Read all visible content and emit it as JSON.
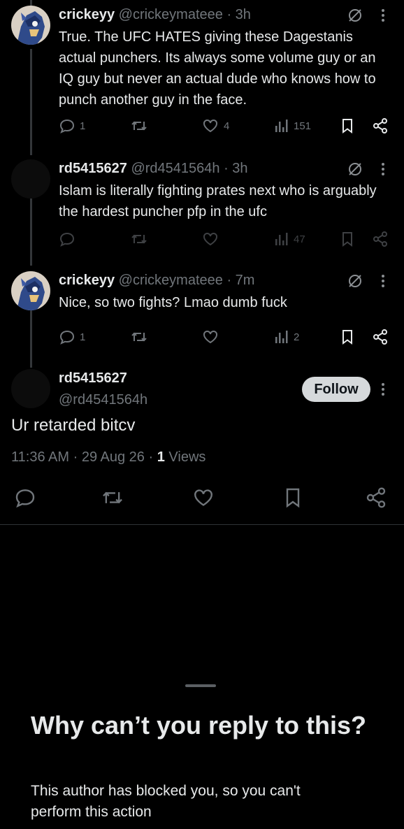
{
  "replies": [
    {
      "name": "crickeyy",
      "handle": "@crickeymateee",
      "time": "· 3h",
      "text": "True. The UFC HATES giving these Dagestanis actual punchers. Its always some volume guy or an IQ guy but never an actual dude who knows how to punch another guy in the face.",
      "replies": "1",
      "retweets": "",
      "likes": "4",
      "views": "151"
    },
    {
      "name": "rd5415627",
      "handle": "@rd4541564h",
      "time": "· 3h",
      "text": "Islam is literally fighting prates next who is arguably the hardest puncher pfp in the ufc",
      "replies": "",
      "retweets": "",
      "likes": "",
      "views": "47"
    },
    {
      "name": "crickeyy",
      "handle": "@crickeymateee",
      "time": "· 7m",
      "text": "Nice, so two fights? Lmao dumb fuck",
      "replies": "1",
      "retweets": "",
      "likes": "",
      "views": "2"
    }
  ],
  "main_post": {
    "name": "rd5415627",
    "handle": "@rd4541564h",
    "follow_label": "Follow",
    "text": "Ur retarded bitcv",
    "time": "11:36 AM",
    "date": "29 Aug 26",
    "sep": "·",
    "views_count": "1",
    "views_label": "Views"
  },
  "sheet": {
    "title": "Why can’t you reply to this?",
    "subtitle": "This author has blocked you, so you can't perform this action"
  },
  "colors": {
    "background": "#000000",
    "text": "#e7e9ea",
    "muted": "#71767b",
    "follow_bg": "#d6d9db"
  }
}
